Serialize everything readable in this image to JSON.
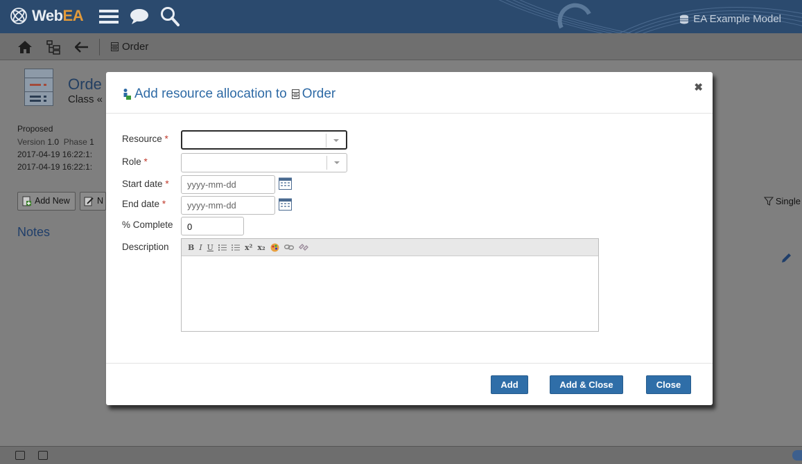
{
  "app": {
    "logo_text_a": "Web",
    "logo_text_b": "EA",
    "model_name": "EA Example Model"
  },
  "nav": {
    "breadcrumb": "Order"
  },
  "background": {
    "element_title": "Orde",
    "element_subtitle": "Class «",
    "status": "Proposed",
    "version_label": "Version",
    "version_value": "1.0",
    "phase_label": "Phase",
    "phase_value": "1",
    "created": "2017-04-19 16:22:1:",
    "modified": "2017-04-19 16:22:1:",
    "add_new_label": "Add New",
    "second_button_label": "N",
    "notes_title": "Notes",
    "single_label": "Single"
  },
  "dialog": {
    "title": "Add resource allocation to",
    "title_target": "Order",
    "close_glyph": "✖",
    "fields": {
      "resource_label": "Resource",
      "role_label": "Role",
      "start_label": "Start date",
      "end_label": "End date",
      "complete_label": "% Complete",
      "description_label": "Description",
      "required_mark": "*",
      "date_placeholder": "yyyy-mm-dd",
      "complete_value": "0"
    },
    "toolbar": [
      "B",
      "I",
      "U",
      "x²",
      "x₂"
    ],
    "buttons": {
      "add": "Add",
      "add_close": "Add & Close",
      "close": "Close"
    }
  }
}
